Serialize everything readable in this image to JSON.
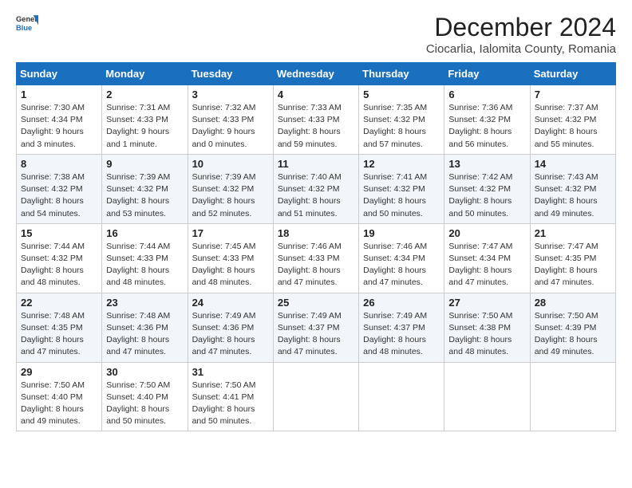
{
  "logo": {
    "general": "General",
    "blue": "Blue"
  },
  "title": "December 2024",
  "subtitle": "Ciocarlia, Ialomita County, Romania",
  "days_header": [
    "Sunday",
    "Monday",
    "Tuesday",
    "Wednesday",
    "Thursday",
    "Friday",
    "Saturday"
  ],
  "weeks": [
    [
      {
        "day": "1",
        "sunrise": "Sunrise: 7:30 AM",
        "sunset": "Sunset: 4:34 PM",
        "daylight": "Daylight: 9 hours and 3 minutes."
      },
      {
        "day": "2",
        "sunrise": "Sunrise: 7:31 AM",
        "sunset": "Sunset: 4:33 PM",
        "daylight": "Daylight: 9 hours and 1 minute."
      },
      {
        "day": "3",
        "sunrise": "Sunrise: 7:32 AM",
        "sunset": "Sunset: 4:33 PM",
        "daylight": "Daylight: 9 hours and 0 minutes."
      },
      {
        "day": "4",
        "sunrise": "Sunrise: 7:33 AM",
        "sunset": "Sunset: 4:33 PM",
        "daylight": "Daylight: 8 hours and 59 minutes."
      },
      {
        "day": "5",
        "sunrise": "Sunrise: 7:35 AM",
        "sunset": "Sunset: 4:32 PM",
        "daylight": "Daylight: 8 hours and 57 minutes."
      },
      {
        "day": "6",
        "sunrise": "Sunrise: 7:36 AM",
        "sunset": "Sunset: 4:32 PM",
        "daylight": "Daylight: 8 hours and 56 minutes."
      },
      {
        "day": "7",
        "sunrise": "Sunrise: 7:37 AM",
        "sunset": "Sunset: 4:32 PM",
        "daylight": "Daylight: 8 hours and 55 minutes."
      }
    ],
    [
      {
        "day": "8",
        "sunrise": "Sunrise: 7:38 AM",
        "sunset": "Sunset: 4:32 PM",
        "daylight": "Daylight: 8 hours and 54 minutes."
      },
      {
        "day": "9",
        "sunrise": "Sunrise: 7:39 AM",
        "sunset": "Sunset: 4:32 PM",
        "daylight": "Daylight: 8 hours and 53 minutes."
      },
      {
        "day": "10",
        "sunrise": "Sunrise: 7:39 AM",
        "sunset": "Sunset: 4:32 PM",
        "daylight": "Daylight: 8 hours and 52 minutes."
      },
      {
        "day": "11",
        "sunrise": "Sunrise: 7:40 AM",
        "sunset": "Sunset: 4:32 PM",
        "daylight": "Daylight: 8 hours and 51 minutes."
      },
      {
        "day": "12",
        "sunrise": "Sunrise: 7:41 AM",
        "sunset": "Sunset: 4:32 PM",
        "daylight": "Daylight: 8 hours and 50 minutes."
      },
      {
        "day": "13",
        "sunrise": "Sunrise: 7:42 AM",
        "sunset": "Sunset: 4:32 PM",
        "daylight": "Daylight: 8 hours and 50 minutes."
      },
      {
        "day": "14",
        "sunrise": "Sunrise: 7:43 AM",
        "sunset": "Sunset: 4:32 PM",
        "daylight": "Daylight: 8 hours and 49 minutes."
      }
    ],
    [
      {
        "day": "15",
        "sunrise": "Sunrise: 7:44 AM",
        "sunset": "Sunset: 4:32 PM",
        "daylight": "Daylight: 8 hours and 48 minutes."
      },
      {
        "day": "16",
        "sunrise": "Sunrise: 7:44 AM",
        "sunset": "Sunset: 4:33 PM",
        "daylight": "Daylight: 8 hours and 48 minutes."
      },
      {
        "day": "17",
        "sunrise": "Sunrise: 7:45 AM",
        "sunset": "Sunset: 4:33 PM",
        "daylight": "Daylight: 8 hours and 48 minutes."
      },
      {
        "day": "18",
        "sunrise": "Sunrise: 7:46 AM",
        "sunset": "Sunset: 4:33 PM",
        "daylight": "Daylight: 8 hours and 47 minutes."
      },
      {
        "day": "19",
        "sunrise": "Sunrise: 7:46 AM",
        "sunset": "Sunset: 4:34 PM",
        "daylight": "Daylight: 8 hours and 47 minutes."
      },
      {
        "day": "20",
        "sunrise": "Sunrise: 7:47 AM",
        "sunset": "Sunset: 4:34 PM",
        "daylight": "Daylight: 8 hours and 47 minutes."
      },
      {
        "day": "21",
        "sunrise": "Sunrise: 7:47 AM",
        "sunset": "Sunset: 4:35 PM",
        "daylight": "Daylight: 8 hours and 47 minutes."
      }
    ],
    [
      {
        "day": "22",
        "sunrise": "Sunrise: 7:48 AM",
        "sunset": "Sunset: 4:35 PM",
        "daylight": "Daylight: 8 hours and 47 minutes."
      },
      {
        "day": "23",
        "sunrise": "Sunrise: 7:48 AM",
        "sunset": "Sunset: 4:36 PM",
        "daylight": "Daylight: 8 hours and 47 minutes."
      },
      {
        "day": "24",
        "sunrise": "Sunrise: 7:49 AM",
        "sunset": "Sunset: 4:36 PM",
        "daylight": "Daylight: 8 hours and 47 minutes."
      },
      {
        "day": "25",
        "sunrise": "Sunrise: 7:49 AM",
        "sunset": "Sunset: 4:37 PM",
        "daylight": "Daylight: 8 hours and 47 minutes."
      },
      {
        "day": "26",
        "sunrise": "Sunrise: 7:49 AM",
        "sunset": "Sunset: 4:37 PM",
        "daylight": "Daylight: 8 hours and 48 minutes."
      },
      {
        "day": "27",
        "sunrise": "Sunrise: 7:50 AM",
        "sunset": "Sunset: 4:38 PM",
        "daylight": "Daylight: 8 hours and 48 minutes."
      },
      {
        "day": "28",
        "sunrise": "Sunrise: 7:50 AM",
        "sunset": "Sunset: 4:39 PM",
        "daylight": "Daylight: 8 hours and 49 minutes."
      }
    ],
    [
      {
        "day": "29",
        "sunrise": "Sunrise: 7:50 AM",
        "sunset": "Sunset: 4:40 PM",
        "daylight": "Daylight: 8 hours and 49 minutes."
      },
      {
        "day": "30",
        "sunrise": "Sunrise: 7:50 AM",
        "sunset": "Sunset: 4:40 PM",
        "daylight": "Daylight: 8 hours and 50 minutes."
      },
      {
        "day": "31",
        "sunrise": "Sunrise: 7:50 AM",
        "sunset": "Sunset: 4:41 PM",
        "daylight": "Daylight: 8 hours and 50 minutes."
      },
      null,
      null,
      null,
      null
    ]
  ]
}
